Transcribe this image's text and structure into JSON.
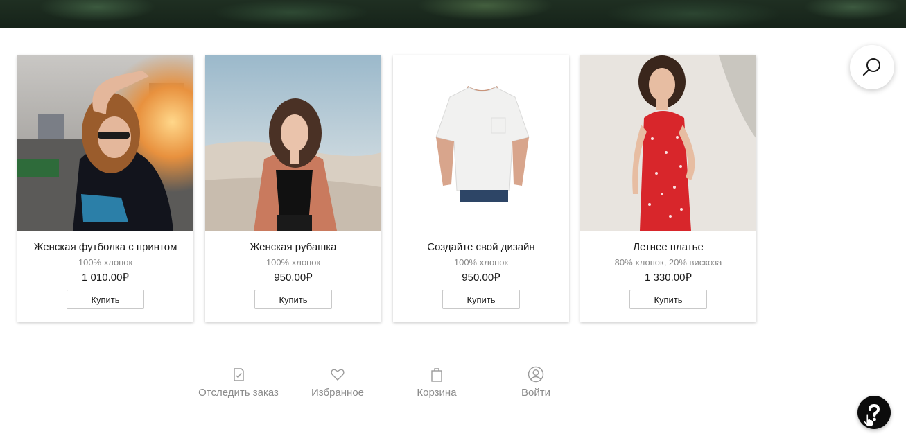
{
  "products": [
    {
      "title": "Женская футболка с принтом",
      "material": "100% хлопок",
      "price": "1 010.00₽",
      "buy_label": "Купить",
      "image": "woman-sunglasses-tshirt-photo"
    },
    {
      "title": "Женская рубашка",
      "material": "100% хлопок",
      "price": "950.00₽",
      "buy_label": "Купить",
      "image": "woman-beach-shirt-photo"
    },
    {
      "title": "Создайте свой дизайн",
      "material": "100% хлопок",
      "price": "950.00₽",
      "buy_label": "Купить",
      "image": "white-tshirt-photo"
    },
    {
      "title": "Летнее платье",
      "material": "80% хлопок, 20% вискоза",
      "price": "1 330.00₽",
      "buy_label": "Купить",
      "image": "woman-red-dress-photo"
    }
  ],
  "bottom_nav": [
    {
      "label": "Отследить заказ",
      "icon": "order-tracking-icon"
    },
    {
      "label": "Избранное",
      "icon": "heart-icon"
    },
    {
      "label": "Корзина",
      "icon": "shopping-bag-icon"
    },
    {
      "label": "Войти",
      "icon": "user-icon"
    }
  ],
  "widgets": {
    "search_icon": "search-icon",
    "help_icon": "question-icon"
  },
  "colors": {
    "hero": "#1c2b1f",
    "price_text": "#1a1a1a",
    "muted_text": "#8a8a8a",
    "help_button": "#0c0c0c"
  }
}
